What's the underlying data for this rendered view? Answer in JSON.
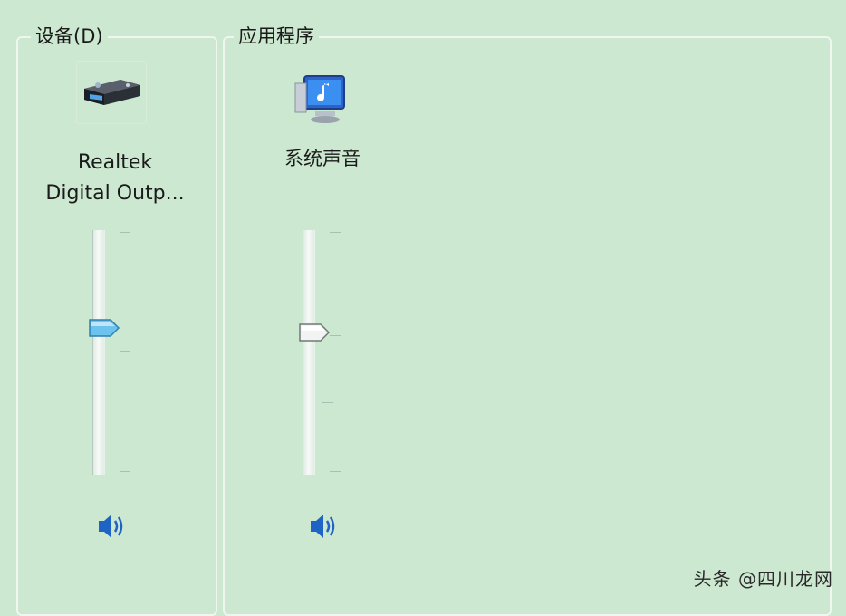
{
  "device": {
    "legend": "设备(D)",
    "name_line1": "Realtek",
    "name_line2": "Digital Outp...",
    "icon": "audio-receiver-icon",
    "volume_level": 0.6
  },
  "applications": {
    "legend": "应用程序",
    "items": [
      {
        "name": "系统声音",
        "icon": "system-sounds-icon",
        "volume_level": 0.58
      }
    ]
  },
  "watermark": "头条 @四川龙网",
  "colors": {
    "background": "#cce8d0",
    "device_thumb": "#5fb8e6",
    "app_thumb": "#f2f4f3",
    "speaker": "#1f64c4"
  }
}
